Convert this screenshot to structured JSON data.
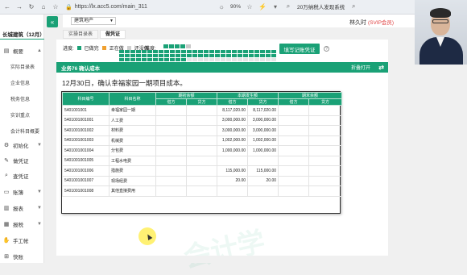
{
  "browser": {
    "url": "https://lx.acc5.com/main_311",
    "zoom": "90%",
    "news": "20万纳税人发现系统"
  },
  "sidebar": {
    "company": "长城建筑（12月）",
    "items": [
      {
        "icon": "menu-icon",
        "label": "概要"
      },
      {
        "icon": "gear-icon",
        "label": "初始化"
      },
      {
        "icon": "edit-icon",
        "label": "做凭证"
      },
      {
        "icon": "search-icon",
        "label": "查凭证"
      },
      {
        "icon": "book-icon",
        "label": "账簿"
      },
      {
        "icon": "report-icon",
        "label": "报表"
      },
      {
        "icon": "tax-icon",
        "label": "报税"
      },
      {
        "icon": "hand-icon",
        "label": "手工帐"
      },
      {
        "icon": "cart-icon",
        "label": "快账"
      }
    ],
    "subitems": [
      "实际目录表",
      "企业信息",
      "税务信息",
      "实训重点",
      "会计科目概要"
    ]
  },
  "topbar": {
    "client": "建筑地产",
    "user": "林久时",
    "vip": "(SVIP会员)"
  },
  "tabs": [
    {
      "label": "实操目录表",
      "active": false
    },
    {
      "label": "做凭证",
      "active": true
    }
  ],
  "progress": {
    "label": "进度:",
    "done": "已做完",
    "doing": "正在做",
    "todo": "还没做",
    "difficulty_label": "难度:",
    "difficulty_value": 4,
    "difficulty_max": 5,
    "done_count": 68,
    "total_count": 84,
    "colors": {
      "done": "#1aa176",
      "doing": "#f0a030",
      "todo": "#cfcfcf"
    }
  },
  "fill_button": "填写记账凭证",
  "business": {
    "title": "业务76 确认成本",
    "fold_label": "折叠打开",
    "task": "12月30日，确认幸福家园一期项目成本。"
  },
  "watermark": "会计学",
  "ledger": {
    "headers_top": [
      "科目编号",
      "科目名称",
      "期初余额",
      "本期发生额",
      "期末余额"
    ],
    "headers_sub": [
      "借方",
      "贷方",
      "借方",
      "贷方",
      "借方",
      "贷方"
    ],
    "rows": [
      {
        "code": "5401001001",
        "name": "幸福家园一期",
        "open_debit": "",
        "open_credit": "",
        "debit": "8,117,020.00",
        "credit": "8,117,020.00",
        "close_debit": "",
        "close_credit": ""
      },
      {
        "code": "5401001001001",
        "name": "人工费",
        "open_debit": "",
        "open_credit": "",
        "debit": "3,000,000.00",
        "credit": "3,000,000.00",
        "close_debit": "",
        "close_credit": ""
      },
      {
        "code": "5401001001002",
        "name": "材料费",
        "open_debit": "",
        "open_credit": "",
        "debit": "3,000,000.00",
        "credit": "3,000,000.00",
        "close_debit": "",
        "close_credit": ""
      },
      {
        "code": "5401001001003",
        "name": "机械费",
        "open_debit": "",
        "open_credit": "",
        "debit": "1,002,000.00",
        "credit": "1,002,000.00",
        "close_debit": "",
        "close_credit": ""
      },
      {
        "code": "5401001001004",
        "name": "分包费",
        "open_debit": "",
        "open_credit": "",
        "debit": "1,000,000.00",
        "credit": "1,000,000.00",
        "close_debit": "",
        "close_credit": ""
      },
      {
        "code": "5401001001005",
        "name": "工程水电费",
        "open_debit": "",
        "open_credit": "",
        "debit": "",
        "credit": "",
        "close_debit": "",
        "close_credit": ""
      },
      {
        "code": "5401001001006",
        "name": "措施费",
        "open_debit": "",
        "open_credit": "",
        "debit": "115,000.00",
        "credit": "115,000.00",
        "close_debit": "",
        "close_credit": ""
      },
      {
        "code": "5401001001007",
        "name": "现场经费",
        "open_debit": "",
        "open_credit": "",
        "debit": "20.00",
        "credit": "20.00",
        "close_debit": "",
        "close_credit": ""
      },
      {
        "code": "5401001001008",
        "name": "其他直接费用",
        "open_debit": "",
        "open_credit": "",
        "debit": "",
        "credit": "",
        "close_debit": "",
        "close_credit": ""
      }
    ]
  }
}
